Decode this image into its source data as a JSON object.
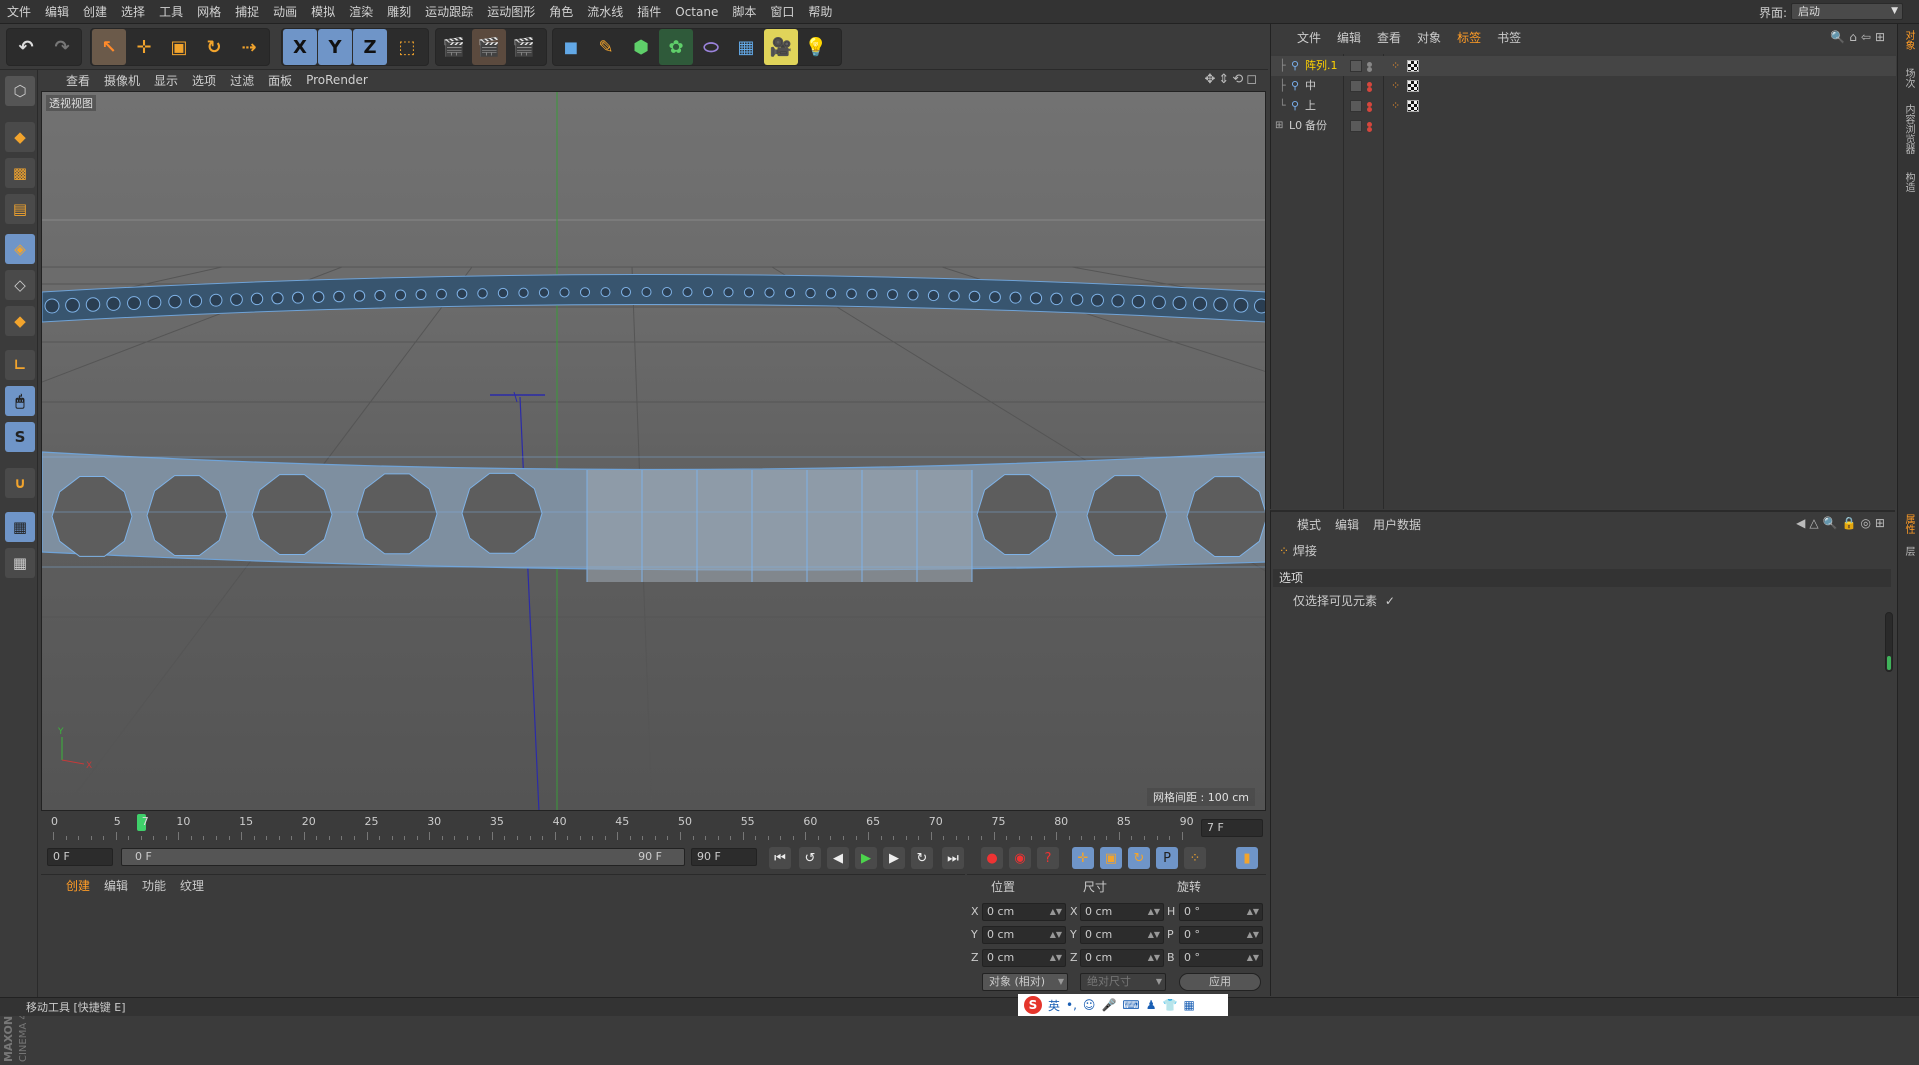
{
  "menubar": {
    "items": [
      "文件",
      "编辑",
      "创建",
      "选择",
      "工具",
      "网格",
      "捕捉",
      "动画",
      "模拟",
      "渲染",
      "雕刻",
      "运动跟踪",
      "运动图形",
      "角色",
      "流水线",
      "插件",
      "Octane",
      "脚本",
      "窗口",
      "帮助"
    ],
    "layout_label": "界面:",
    "layout_value": "启动"
  },
  "toolbar": {
    "undo_icon": "undo-icon",
    "redo_icon": "redo-icon",
    "axis_x": "X",
    "axis_y": "Y",
    "axis_z": "Z"
  },
  "left_tools": {
    "snap": "S"
  },
  "viewport": {
    "menu": [
      "查看",
      "摄像机",
      "显示",
      "选项",
      "过滤",
      "面板",
      "ProRender"
    ],
    "title": "透视视图",
    "grid_spacing": "网格间距 : 100 cm",
    "axis_y": "Y",
    "axis_x": "X"
  },
  "timeline": {
    "ticks": [
      "0",
      "5",
      "10",
      "15",
      "20",
      "25",
      "30",
      "35",
      "40",
      "45",
      "50",
      "55",
      "60",
      "65",
      "70",
      "75",
      "80",
      "85",
      "90"
    ],
    "current_marker": "7",
    "current_frame_field": "7 F",
    "current_frame": 7,
    "total_frames": 90
  },
  "transport": {
    "start_field": "0 F",
    "range_start": "0 F",
    "range_end": "90 F",
    "end_field": "90 F"
  },
  "material_manager": {
    "tabs": [
      "创建",
      "编辑",
      "功能",
      "纹理"
    ]
  },
  "coordinates": {
    "headers": [
      "位置",
      "尺寸",
      "旋转"
    ],
    "rows": [
      {
        "pos_label": "X",
        "pos": "0 cm",
        "size_label": "X",
        "size": "0 cm",
        "rot_label": "H",
        "rot": "0 °"
      },
      {
        "pos_label": "Y",
        "pos": "0 cm",
        "size_label": "Y",
        "size": "0 cm",
        "rot_label": "P",
        "rot": "0 °"
      },
      {
        "pos_label": "Z",
        "pos": "0 cm",
        "size_label": "Z",
        "size": "0 cm",
        "rot_label": "B",
        "rot": "0 °"
      }
    ],
    "mode": "对象 (相对)",
    "size_mode": "绝对尺寸",
    "apply": "应用"
  },
  "object_manager": {
    "tabs": [
      "文件",
      "编辑",
      "查看",
      "对象",
      "标签",
      "书签"
    ],
    "objects": [
      {
        "name": "阵列.1",
        "selected": true
      },
      {
        "name": "中",
        "selected": false
      },
      {
        "name": "上",
        "selected": false
      },
      {
        "name": "备份",
        "selected": false
      }
    ]
  },
  "attribute_manager": {
    "tabs": [
      "模式",
      "编辑",
      "用户数据"
    ],
    "object": "焊接",
    "section": "选项",
    "option_label": "仅选择可见元素",
    "option_check": "✓"
  },
  "side_tabs": [
    "对象",
    "场次",
    "内容浏览器",
    "构造",
    "属性",
    "层"
  ],
  "status": {
    "text": "移动工具 [快捷键 E]"
  },
  "ime": {
    "items": [
      "S",
      "英",
      "•,",
      "☺",
      "🎤",
      "⌨",
      "♟",
      "👕",
      "▦"
    ]
  },
  "brand": {
    "line1": "MAXON",
    "line2": "CINEMA 4D"
  },
  "colors": {
    "accent": "#ff9c26",
    "selected": "#ffd200",
    "mesh": "#6fa3d8"
  }
}
